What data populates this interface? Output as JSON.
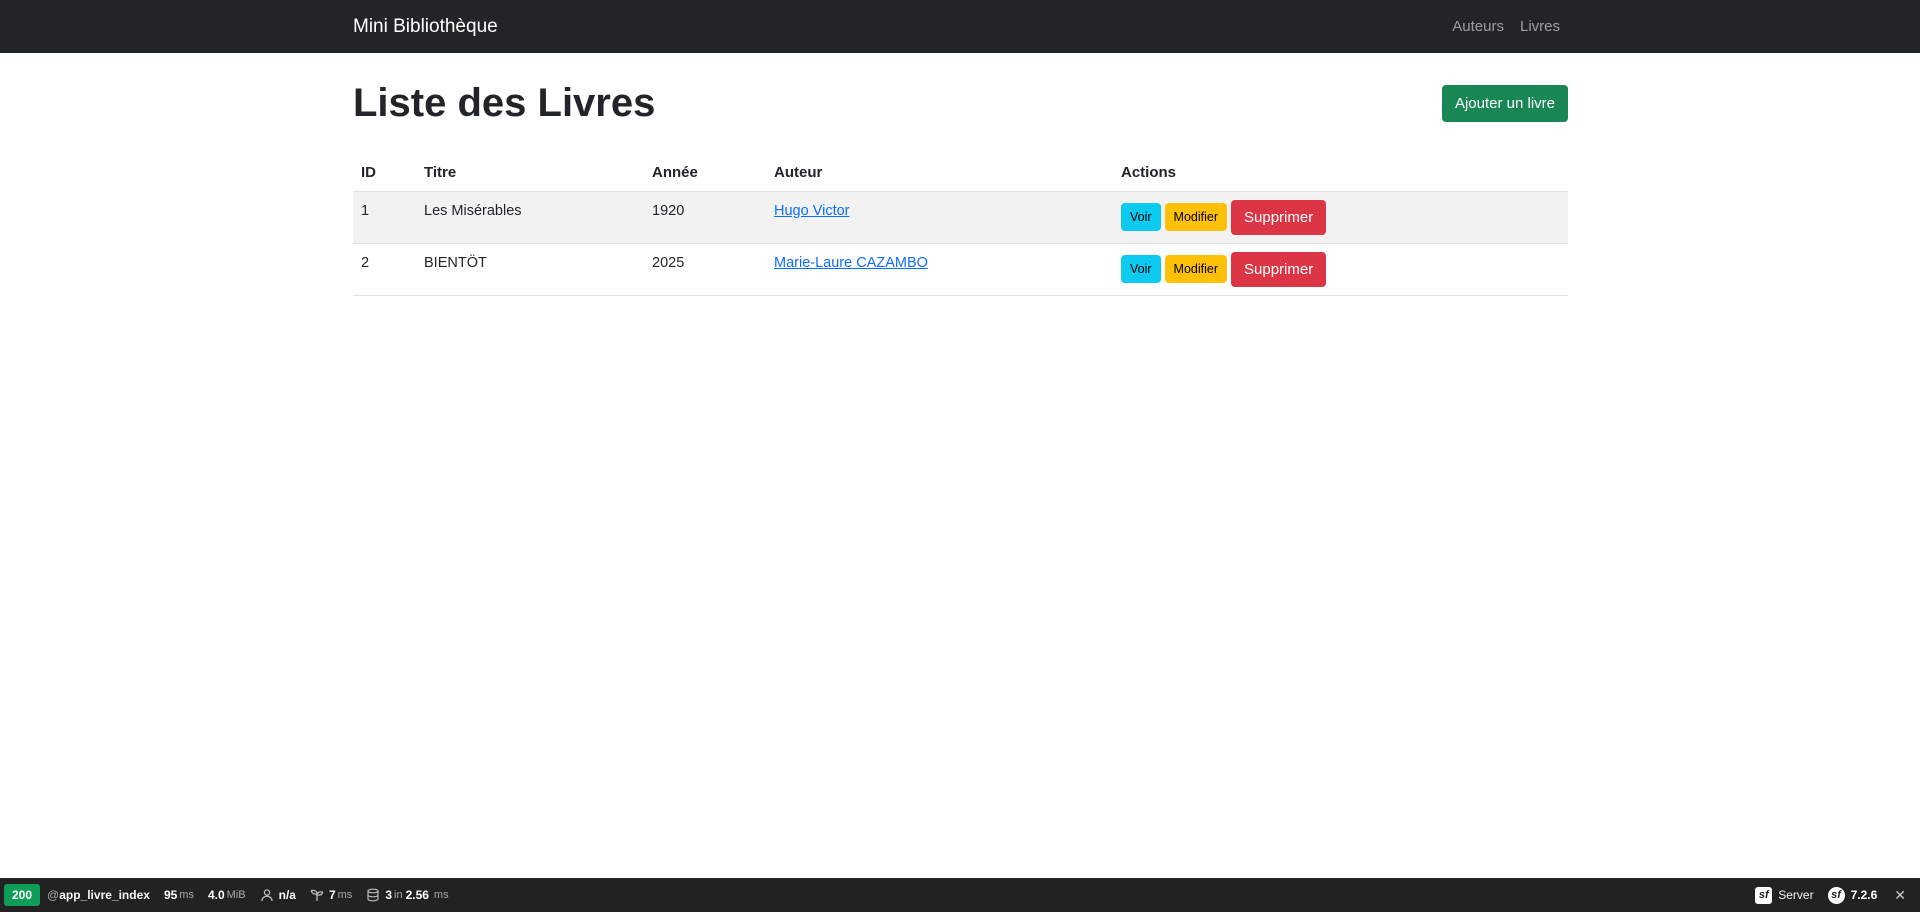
{
  "navbar": {
    "brand": "Mini Bibliothèque",
    "links": [
      {
        "label": "Auteurs"
      },
      {
        "label": "Livres"
      }
    ]
  },
  "page": {
    "title": "Liste des Livres",
    "add_button": "Ajouter un livre"
  },
  "table": {
    "headers": [
      "ID",
      "Titre",
      "Année",
      "Auteur",
      "Actions"
    ],
    "rows": [
      {
        "id": "1",
        "titre": "Les Misérables",
        "annee": "1920",
        "auteur": "Hugo Victor"
      },
      {
        "id": "2",
        "titre": "BIENTÖT",
        "annee": "2025",
        "auteur": "Marie-Laure CAZAMBO"
      }
    ],
    "actions": {
      "view": "Voir",
      "edit": "Modifier",
      "delete": "Supprimer"
    }
  },
  "toolbar": {
    "status": "200",
    "route_prefix": "@",
    "route": "app_livre_index",
    "time_value": "95",
    "time_unit": "ms",
    "memory_value": "4.0",
    "memory_unit": "MiB",
    "user": "n/a",
    "twig_value": "7",
    "twig_unit": "ms",
    "db_count": "3",
    "db_in": "in",
    "db_time": "2.56",
    "db_unit": "ms",
    "server_label": "Server",
    "symfony_version": "7.2.6"
  },
  "colors": {
    "navbar_bg": "#212529",
    "success": "#198754",
    "info": "#0dcaf0",
    "warning": "#ffc107",
    "danger": "#dc3545",
    "link": "#0d6efd",
    "toolbar_bg": "#222222",
    "status_ok": "#0f9d58"
  },
  "icons": {
    "user": "user-icon",
    "twig": "leaf-icon",
    "database": "database-icon",
    "server": "symfony-logo-icon",
    "version": "symfony-logo-icon",
    "close": "close-icon"
  }
}
